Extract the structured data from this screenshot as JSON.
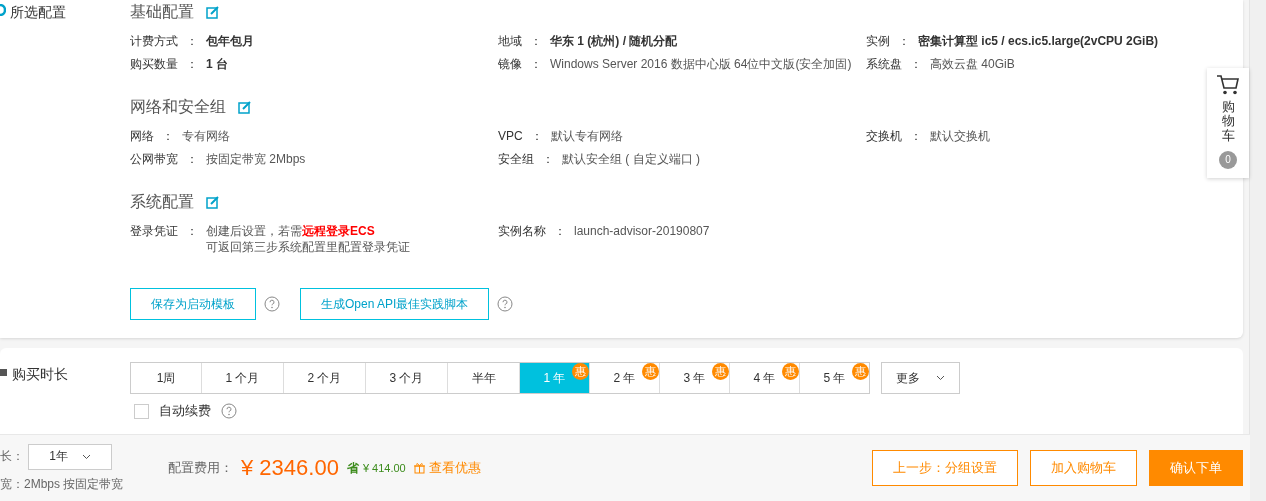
{
  "config_panel": {
    "label": "所选配置",
    "sections": [
      {
        "title": "基础配置",
        "rows": [
          [
            {
              "label": "计费方式",
              "value": "包年包月",
              "emphasized": true
            },
            {
              "label": "地域",
              "value": "华东 1 (杭州) / 随机分配",
              "emphasized": true
            },
            {
              "label": "实例",
              "value": "密集计算型 ic5 / ecs.ic5.large(2vCPU 2GiB)",
              "emphasized": true
            }
          ],
          [
            {
              "label": "购买数量",
              "value": "1 台",
              "emphasized": true
            },
            {
              "label": "镜像",
              "value": "Windows Server 2016 数据中心版 64位中文版(安全加固)",
              "emphasized": false
            },
            {
              "label": "系统盘",
              "value": "高效云盘 40GiB",
              "emphasized": false
            }
          ]
        ]
      },
      {
        "title": "网络和安全组",
        "rows": [
          [
            {
              "label": "网络",
              "value": "专有网络",
              "emphasized": false
            },
            {
              "label": "VPC",
              "value": "默认专有网络",
              "emphasized": false
            },
            {
              "label": "交换机",
              "value": "默认交换机",
              "emphasized": false
            }
          ],
          [
            {
              "label": "公网带宽",
              "value": "按固定带宽 2Mbps",
              "emphasized": false
            },
            {
              "label": "安全组",
              "value": "默认安全组 ( 自定义端口 )",
              "emphasized": false
            }
          ]
        ]
      },
      {
        "title": "系统配置",
        "rows": [
          [
            {
              "label": "登录凭证",
              "value": "创建后设置，若需**远程登录ECS**",
              "note": "可返回第三步系统配置里配置登录凭证",
              "emphasized": false
            },
            {
              "label": "实例名称",
              "value": "launch-advisor-20190807",
              "emphasized": false
            }
          ]
        ]
      }
    ],
    "actions": [
      "保存为启动模板",
      "生成Open API最佳实践脚本"
    ]
  },
  "separator": "：",
  "cart": {
    "label": "购物车",
    "count": "0"
  },
  "duration_panel": {
    "label": "购买时长",
    "options": [
      {
        "label": "1周",
        "selected": false
      },
      {
        "label": "1 个月",
        "selected": false
      },
      {
        "label": "2 个月",
        "selected": false
      },
      {
        "label": "3 个月",
        "selected": false
      },
      {
        "label": "半年",
        "selected": false
      },
      {
        "label": "1 年",
        "selected": true,
        "badge": "惠"
      },
      {
        "label": "2 年",
        "selected": false,
        "badge": "惠"
      },
      {
        "label": "3 年",
        "selected": false,
        "badge": "惠"
      },
      {
        "label": "4 年",
        "selected": false,
        "badge": "惠"
      },
      {
        "label": "5 年",
        "selected": false,
        "badge": "惠"
      }
    ],
    "more": "更多",
    "auto_renew": {
      "label": "自动续费",
      "checked": false
    }
  },
  "footer": {
    "duration_label": "长：",
    "duration_value": "1年",
    "bandwidth": "宽：2Mbps 按固定带宽",
    "price_label": "配置费用：",
    "price": "¥ 2346.00",
    "save_label": "省",
    "save_amount": "¥ 414.00",
    "discount_link": "查看优惠",
    "buttons": [
      {
        "label": "上一步：分组设置",
        "kind": "outline"
      },
      {
        "label": "加入购物车",
        "kind": "outline"
      },
      {
        "label": "确认下单",
        "kind": "primary"
      }
    ]
  }
}
